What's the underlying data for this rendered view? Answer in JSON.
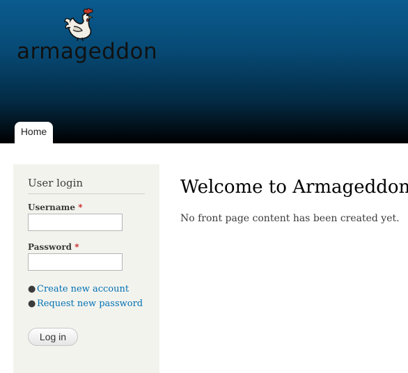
{
  "header": {
    "site_name": "armageddon",
    "logo_icon": "rooster-icon",
    "nav": {
      "home_label": "Home"
    }
  },
  "sidebar": {
    "title": "User login",
    "username_label": "Username",
    "password_label": "Password",
    "required_marker": "*",
    "username_value": "",
    "password_value": "",
    "links": {
      "create_account": "Create new account",
      "request_password": "Request new password"
    },
    "login_button": "Log in"
  },
  "main": {
    "title": "Welcome to Armageddon",
    "body": "No front page content has been created yet."
  },
  "colors": {
    "header_top": "#0a5b8f",
    "header_bottom": "#000000",
    "link": "#0071b3",
    "required": "#c51e1e",
    "sidebar_bg": "#f3f3ee"
  }
}
